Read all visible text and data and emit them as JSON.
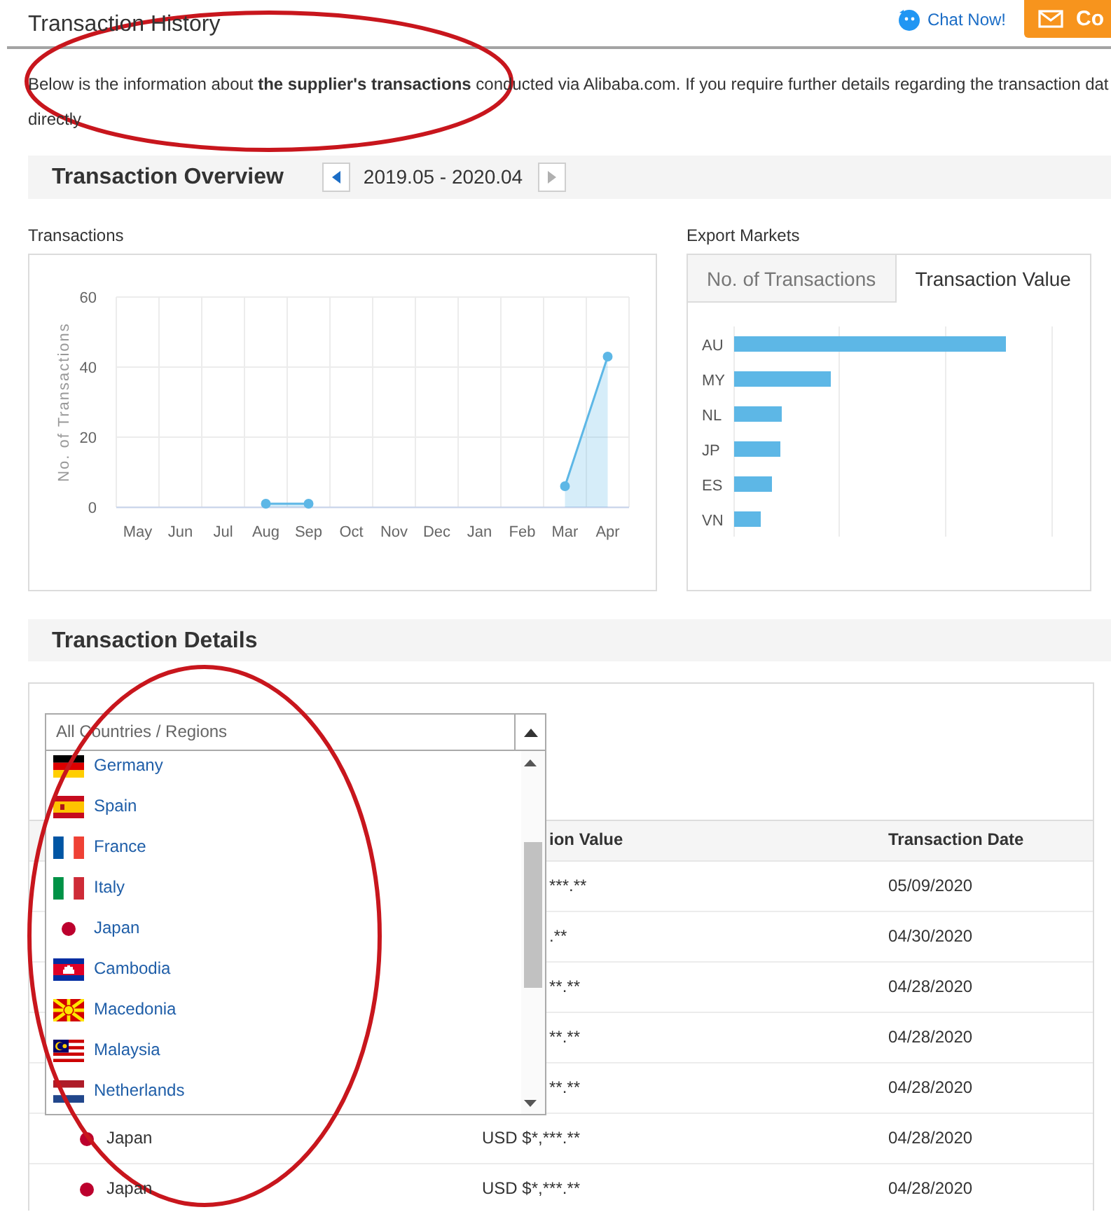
{
  "header": {
    "title": "Transaction History",
    "chat_link": "Chat Now!",
    "contact_button": "Co"
  },
  "intro": {
    "text": "Below is the information about **the supplier's transactions** conducted via Alibaba.com. If you require further details regarding the transaction dat\ndirectly",
    "circled": true
  },
  "overview": {
    "title": "Transaction Overview",
    "period": "2019.05 - 2020.04",
    "prev_button": {
      "disabled": false
    },
    "next_button": {
      "disabled": true
    }
  },
  "transactions_chart": {
    "label": "Transactions",
    "chart_data": {
      "type": "area",
      "ylabel": "No. of Transactions",
      "categories": [
        "May",
        "Jun",
        "Jul",
        "Aug",
        "Sep",
        "Oct",
        "Nov",
        "Dec",
        "Jan",
        "Feb",
        "Mar",
        "Apr"
      ],
      "series": [
        {
          "color": "#5db7e6",
          "values": [
            null,
            null,
            null,
            1,
            1,
            null,
            null,
            null,
            null,
            null,
            6,
            43
          ]
        }
      ],
      "ylim": [
        0,
        60
      ],
      "yticks": [
        0,
        20,
        40,
        60
      ]
    }
  },
  "export_markets": {
    "label": "Export Markets",
    "tabs": [
      {
        "label": "No. of Transactions",
        "selected": false
      },
      {
        "label": "Transaction Value",
        "selected": true
      }
    ],
    "countries": [
      "AU",
      "MY",
      "NL",
      "JP",
      "ES",
      "VN"
    ]
  },
  "details": {
    "title": "Transaction Details",
    "country_dropdown": {
      "value": "All Countries / Regions",
      "expanded": true,
      "circled": true,
      "options": [
        {
          "label": "Germany",
          "kind": "germany"
        },
        {
          "label": "Spain",
          "kind": "spain"
        },
        {
          "label": "France",
          "kind": "france"
        },
        {
          "label": "Italy",
          "kind": "italy"
        },
        {
          "label": "Japan",
          "kind": "japan"
        },
        {
          "label": "Cambodia",
          "kind": "cambodia"
        },
        {
          "label": "Macedonia",
          "kind": "macedonia"
        },
        {
          "label": "Malaysia",
          "kind": "malaysia"
        },
        {
          "label": "Netherlands",
          "kind": "netherlands"
        }
      ]
    },
    "table": {
      "columns": [
        {
          "label": "ion Value",
          "kind": "partial"
        },
        {
          "label": "Transaction Date",
          "kind": "full"
        }
      ],
      "rows": [
        {
          "kind": "partial",
          "value": "***.**",
          "date": "05/09/2020"
        },
        {
          "kind": "partial",
          "value": ".**",
          "date": "04/30/2020"
        },
        {
          "kind": "partial",
          "value": "**.**",
          "date": "04/28/2020"
        },
        {
          "kind": "partial",
          "value": "**.**",
          "date": "04/28/2020"
        },
        {
          "kind": "partial",
          "value": "**.**",
          "date": "04/28/2020"
        },
        {
          "kind": "full",
          "country": {
            "label": "Japan",
            "kind": "japan"
          },
          "value": "USD $*,***.**",
          "date": "04/28/2020"
        },
        {
          "kind": "full",
          "country": {
            "label": "Japan",
            "kind": "japan"
          },
          "value": "USD $*,***.**",
          "date": "04/28/2020"
        }
      ]
    }
  }
}
